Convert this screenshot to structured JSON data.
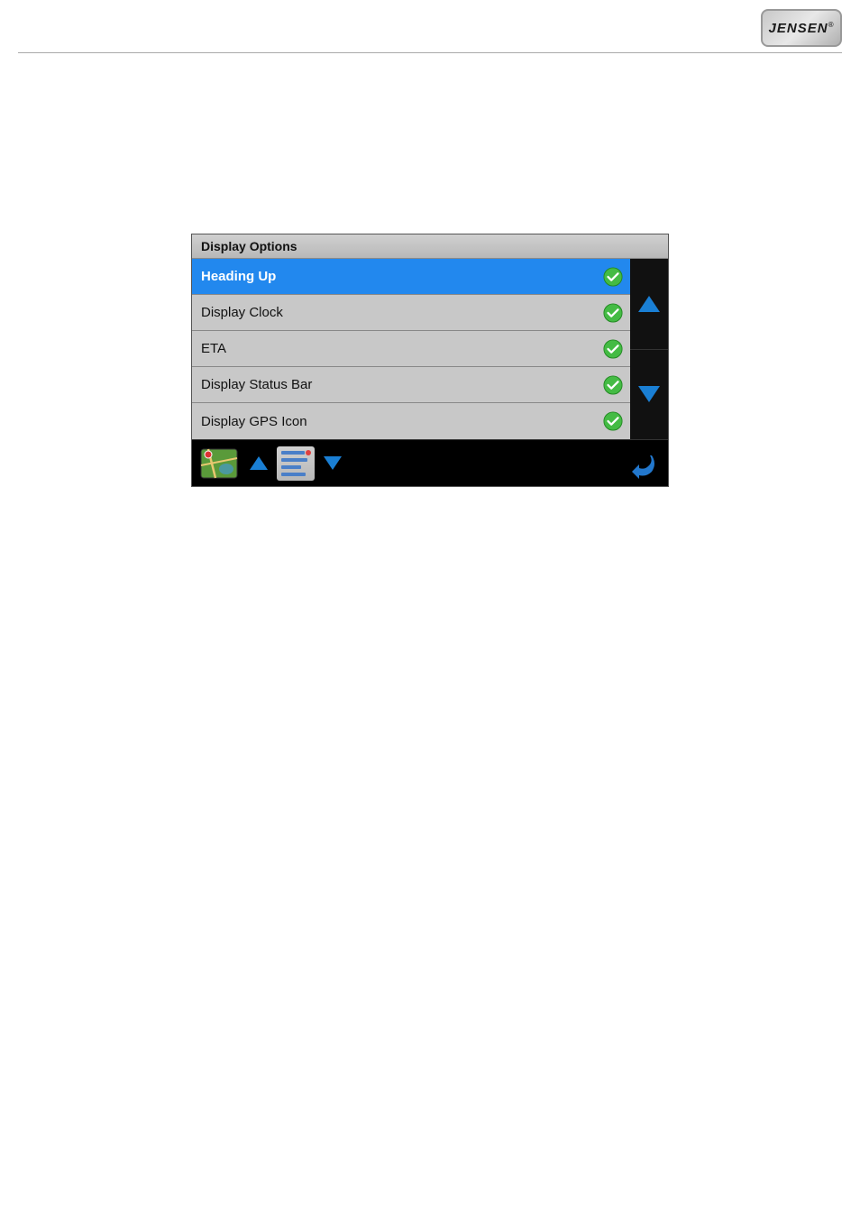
{
  "header": {
    "logo_text": "JENSEN",
    "logo_reg": "®"
  },
  "dialog": {
    "title": "Display Options",
    "rows": [
      {
        "id": "heading-up",
        "label": "Heading Up",
        "checked": true,
        "selected": true
      },
      {
        "id": "display-clock",
        "label": "Display Clock",
        "checked": true,
        "selected": false
      },
      {
        "id": "eta",
        "label": "ETA",
        "checked": true,
        "selected": false
      },
      {
        "id": "display-status-bar",
        "label": "Display Status Bar",
        "checked": true,
        "selected": false
      },
      {
        "id": "display-gps-icon",
        "label": "Display GPS Icon",
        "checked": true,
        "selected": false
      }
    ],
    "scroll_up_label": "scroll up",
    "scroll_down_label": "scroll down"
  },
  "toolbar": {
    "map_label": "map",
    "up_label": "up",
    "list_label": "list",
    "down_label": "down",
    "back_label": "back"
  },
  "colors": {
    "selected_bg": "#2288ee",
    "arrow_blue": "#1a7fd4",
    "check_green": "#44bb44",
    "row_bg": "#c8c8c8",
    "title_bg": "#c8c8c8"
  }
}
